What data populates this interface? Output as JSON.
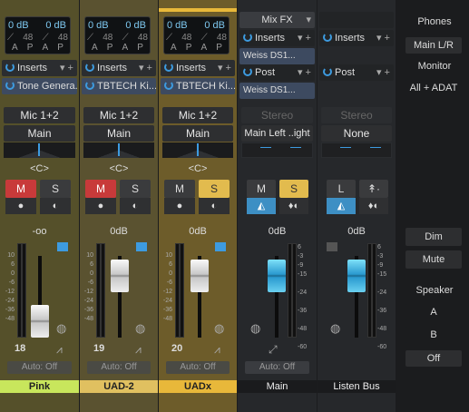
{
  "channels": [
    {
      "name": "Pink",
      "color": "#c8e65c",
      "meter_l": "0 dB",
      "meter_r": "0 dB",
      "meter_48": "48",
      "a": "A",
      "p": "P",
      "inserts_label": "Inserts",
      "plugin": "Tone Genera...",
      "input": "Mic 1+2",
      "output": "Main",
      "pan": "<C>",
      "mute": "M",
      "solo": "S",
      "volume": "-oo",
      "number": "18",
      "auto": "Auto: Off"
    },
    {
      "name": "UAD-2",
      "color": "#e0c060",
      "meter_l": "0 dB",
      "meter_r": "0 dB",
      "meter_48": "48",
      "a": "A",
      "p": "P",
      "inserts_label": "Inserts",
      "plugin": "TBTECH Ki...",
      "input": "Mic 1+2",
      "output": "Main",
      "pan": "<C>",
      "mute": "M",
      "solo": "S",
      "volume": "0dB",
      "number": "19",
      "auto": "Auto: Off"
    },
    {
      "name": "UADx",
      "color": "#e8b83a",
      "meter_l": "0 dB",
      "meter_r": "0 dB",
      "meter_48": "48",
      "a": "A",
      "p": "P",
      "inserts_label": "Inserts",
      "plugin": "TBTECH Ki...",
      "input": "Mic 1+2",
      "output": "Main",
      "pan": "<C>",
      "mute": "M",
      "solo": "S",
      "volume": "0dB",
      "number": "20",
      "auto": "Auto: Off"
    }
  ],
  "main": {
    "name": "Main",
    "mixfx": "Mix FX",
    "inserts_label": "Inserts",
    "plugin1": "Weiss DS1...",
    "post_label": "Post",
    "plugin2": "Weiss DS1...",
    "input": "Stereo",
    "output": "Main Left ..ight",
    "mute": "M",
    "solo": "S",
    "volume": "0dB",
    "auto": "Auto: Off"
  },
  "listen": {
    "name": "Listen Bus",
    "inserts_label": "Inserts",
    "post_label": "Post",
    "input": "Stereo",
    "output": "None",
    "l": "L",
    "volume": "0dB"
  },
  "scale_main": [
    "10",
    "6",
    "0",
    "-6",
    "-12",
    "-24",
    "-36",
    "-48"
  ],
  "scale_bus": [
    "6",
    "-3",
    "-9",
    "-15",
    "-24",
    "-36",
    "-48",
    "-60"
  ],
  "right_panel": {
    "phones": "Phones",
    "phones_value": "Main L/R",
    "monitor": "Monitor",
    "monitor_value": "All + ADAT",
    "dim": "Dim",
    "mute": "Mute",
    "speaker": "Speaker",
    "a": "A",
    "b": "B",
    "off": "Off"
  },
  "colors": {
    "accent": "#3d9be0",
    "mute_on": "#c83a3a",
    "solo_on": "#e2bb4e"
  }
}
